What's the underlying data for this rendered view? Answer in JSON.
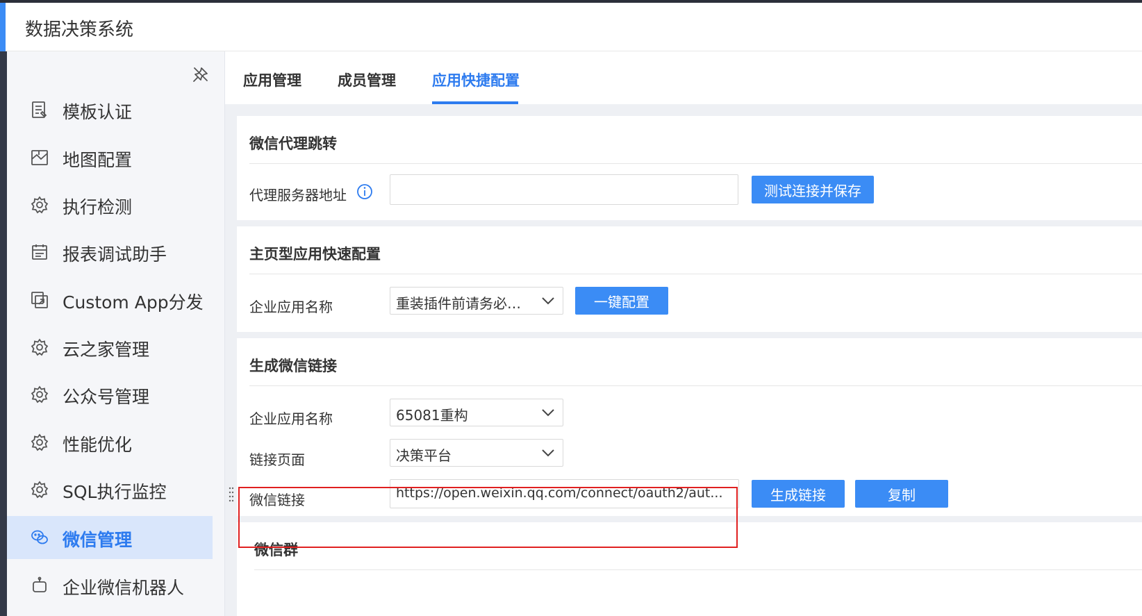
{
  "app": {
    "title": "数据决策系统"
  },
  "sidebar": {
    "items": [
      {
        "label": "模板认证",
        "icon": "template-cert-icon"
      },
      {
        "label": "地图配置",
        "icon": "map-icon"
      },
      {
        "label": "执行检测",
        "icon": "gear-icon"
      },
      {
        "label": "报表调试助手",
        "icon": "calendar-icon"
      },
      {
        "label": "Custom App分发",
        "icon": "app-share-icon"
      },
      {
        "label": "云之家管理",
        "icon": "gear-icon"
      },
      {
        "label": "公众号管理",
        "icon": "gear-icon"
      },
      {
        "label": "性能优化",
        "icon": "gear-icon"
      },
      {
        "label": "SQL执行监控",
        "icon": "gear-icon"
      },
      {
        "label": "微信管理",
        "icon": "wechat-icon",
        "active": true
      },
      {
        "label": "企业微信机器人",
        "icon": "robot-icon"
      }
    ]
  },
  "tabs": [
    {
      "label": "应用管理"
    },
    {
      "label": "成员管理"
    },
    {
      "label": "应用快捷配置",
      "active": true
    }
  ],
  "proxy": {
    "title": "微信代理跳转",
    "label": "代理服务器地址",
    "value": "",
    "button": "测试连接并保存"
  },
  "homepage_config": {
    "title": "主页型应用快速配置",
    "label": "企业应用名称",
    "select_value": "重装插件前请务必…",
    "button": "一键配置"
  },
  "link_gen": {
    "title": "生成微信链接",
    "app_label": "企业应用名称",
    "app_value": "65081重构",
    "page_label": "链接页面",
    "page_value": "决策平台",
    "link_label": "微信链接",
    "link_value": "https://open.weixin.qq.com/connect/oauth2/aut...",
    "generate_button": "生成链接",
    "copy_button": "复制"
  },
  "wechat_group": {
    "title": "微信群"
  },
  "colors": {
    "accent": "#3b8cf5",
    "active_bg": "#d9e6fb",
    "highlight": "#e02020"
  }
}
